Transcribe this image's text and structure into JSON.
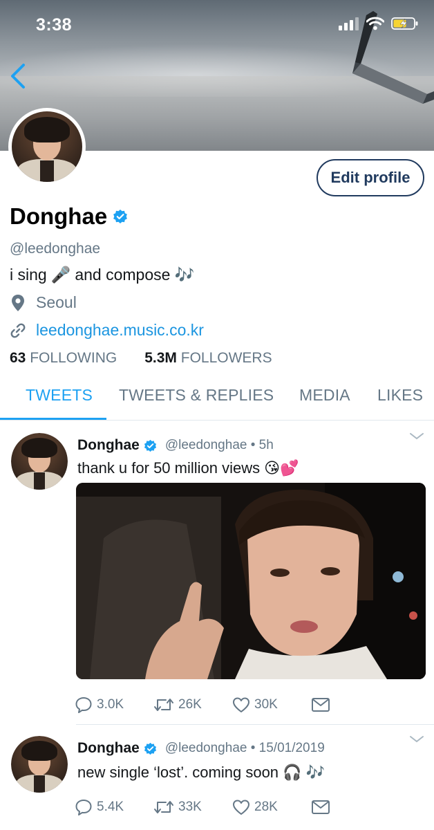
{
  "status_bar": {
    "time": "3:38"
  },
  "profile": {
    "display_name": "Donghae",
    "handle": "@leedonghae",
    "bio_parts": [
      "i sing",
      "🎤",
      "and compose",
      "🎶"
    ],
    "location": "Seoul",
    "website": "leedonghae.music.co.kr",
    "edit_button_label": "Edit profile",
    "following_count": "63",
    "following_label": "FOLLOWING",
    "followers_count": "5.3M",
    "followers_label": "FOLLOWERS"
  },
  "tabs": [
    {
      "label": "TWEETS",
      "active": true
    },
    {
      "label": "TWEETS & REPLIES",
      "active": false
    },
    {
      "label": "MEDIA",
      "active": false
    },
    {
      "label": "LIKES",
      "active": false
    }
  ],
  "tweets": [
    {
      "name": "Donghae",
      "meta": "@leedonghae • 5h",
      "text": "thank u for 50 million views",
      "emoji": "😘💕",
      "replies": "3.0K",
      "retweets": "26K",
      "likes": "30K"
    },
    {
      "name": "Donghae",
      "meta": "@leedonghae • 15/01/2019",
      "text": "new single ‘lost’. coming soon",
      "emoji": "🎧 🎶",
      "replies": "5.4K",
      "retweets": "33K",
      "likes": "28K"
    }
  ],
  "colors": {
    "accent": "#1da1f2",
    "link": "#1b95e0",
    "secondary_text": "#657786",
    "edit_button_border": "#203a5e"
  }
}
